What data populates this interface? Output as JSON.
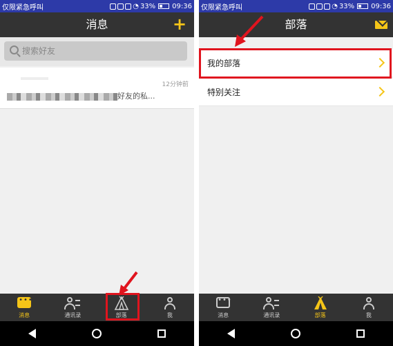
{
  "left": {
    "statusbar": {
      "carrier": "仅限紧急呼叫",
      "battery": "33%",
      "time": "09:36"
    },
    "header": {
      "title": "消息"
    },
    "search": {
      "placeholder": "搜索好友"
    },
    "message": {
      "time": "12分钟前",
      "preview_suffix": "好友的私..."
    },
    "tabs": [
      {
        "label": "消息",
        "icon": "chat-icon"
      },
      {
        "label": "通讯录",
        "icon": "contacts-icon"
      },
      {
        "label": "部落",
        "icon": "tent-icon"
      },
      {
        "label": "我",
        "icon": "person-icon"
      }
    ]
  },
  "right": {
    "statusbar": {
      "carrier": "仅限紧急呼叫",
      "battery": "33%",
      "time": "09:36"
    },
    "header": {
      "title": "部落"
    },
    "rows": [
      {
        "label": "我的部落"
      },
      {
        "label": "特别关注"
      }
    ],
    "tabs": [
      {
        "label": "消息",
        "icon": "chat-icon"
      },
      {
        "label": "通讯录",
        "icon": "contacts-icon"
      },
      {
        "label": "部落",
        "icon": "tent-icon"
      },
      {
        "label": "我",
        "icon": "person-icon"
      }
    ]
  },
  "colors": {
    "accent": "#f5c518",
    "highlight": "#e0141e",
    "statusbar": "#2d3aa8",
    "topbar": "#333333"
  }
}
